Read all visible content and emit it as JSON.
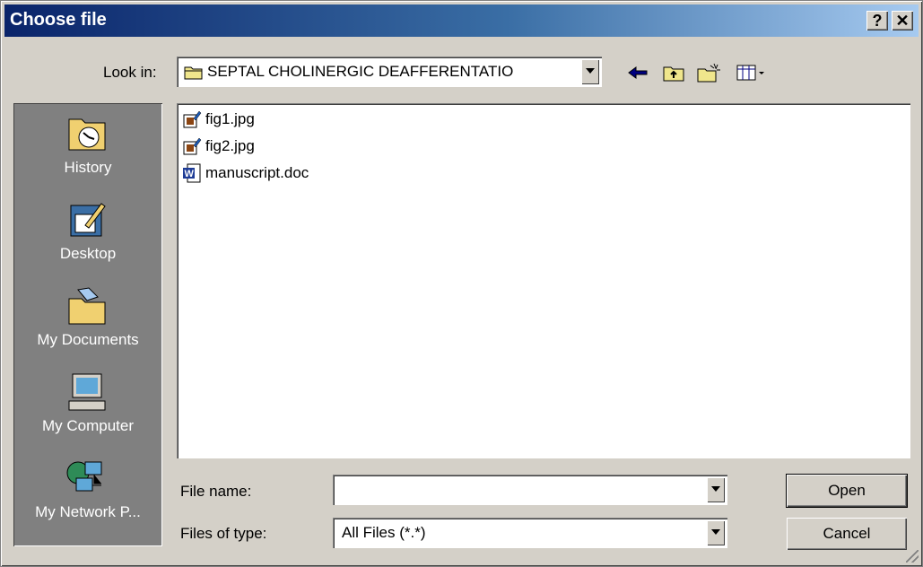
{
  "window": {
    "title": "Choose file",
    "help_label": "?",
    "close_label": "✕"
  },
  "lookin": {
    "label": "Look in:",
    "value": "SEPTAL CHOLINERGIC DEAFFERENTATIO"
  },
  "toolbar": {
    "icons": [
      "back-arrow-icon",
      "up-folder-icon",
      "new-folder-icon",
      "view-menu-icon"
    ]
  },
  "places": [
    {
      "label": "History",
      "icon": "history-icon"
    },
    {
      "label": "Desktop",
      "icon": "desktop-icon"
    },
    {
      "label": "My Documents",
      "icon": "my-documents-icon"
    },
    {
      "label": "My Computer",
      "icon": "my-computer-icon"
    },
    {
      "label": "My Network P...",
      "icon": "network-places-icon"
    }
  ],
  "files": [
    {
      "name": "fig1.jpg",
      "icon": "jpg-file-icon"
    },
    {
      "name": "fig2.jpg",
      "icon": "jpg-file-icon"
    },
    {
      "name": "manuscript.doc",
      "icon": "word-doc-icon"
    }
  ],
  "filename": {
    "label": "File name:",
    "value": ""
  },
  "filetype": {
    "label": "Files of type:",
    "value": "All Files (*.*)"
  },
  "buttons": {
    "open": "Open",
    "cancel": "Cancel"
  },
  "colors": {
    "title_start": "#0a246a",
    "title_end": "#a6caf0",
    "face": "#d4d0c8"
  }
}
